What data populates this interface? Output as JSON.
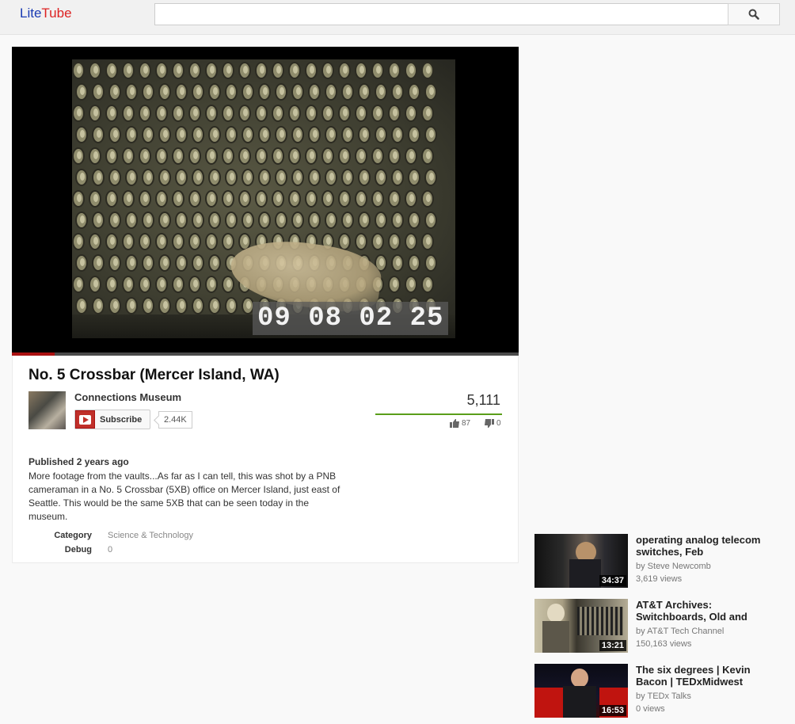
{
  "header": {
    "logo_part1": "Lite",
    "logo_part2": "Tube",
    "search": {
      "value": "",
      "placeholder": ""
    },
    "search_icon": "search-icon"
  },
  "player": {
    "timecode": "09 08 02 25",
    "progress_fraction": 0.085
  },
  "video": {
    "title": "No. 5 Crossbar (Mercer Island, WA)",
    "channel": "Connections Museum",
    "subscribe_label": "Subscribe",
    "subscriber_count": "2.44K",
    "views": "5,111",
    "likes": "87",
    "dislikes": "0",
    "published_label": "Published",
    "published_ago": "2 years ago",
    "description": "More footage from the vaults...As far as I can tell, this was shot by a PNB cameraman in a No. 5 Crossbar (5XB) office on Mercer Island, just east of Seattle. This would be the same 5XB that can be seen today in the museum.",
    "category_label": "Category",
    "category_value": "Science & Technology",
    "debug_label": "Debug",
    "debug_value": "0"
  },
  "recommendations": [
    {
      "title": "operating analog telecom switches, Feb",
      "by": "by Steve Newcomb",
      "views": "3,619 views",
      "duration": "34:37"
    },
    {
      "title": "AT&T Archives: Switchboards, Old and",
      "by": "by AT&T Tech Channel",
      "views": "150,163 views",
      "duration": "13:21"
    },
    {
      "title": "The six degrees | Kevin Bacon | TEDxMidwest",
      "by": "by TEDx Talks",
      "views": "0 views",
      "duration": "16:53"
    }
  ],
  "colors": {
    "logo_lite": "#1a3bb3",
    "logo_tube": "#dd2222",
    "progress": "#aa1111",
    "sentiment_bar": "#5a9e1a",
    "subscribe_icon": "#c0302a"
  }
}
